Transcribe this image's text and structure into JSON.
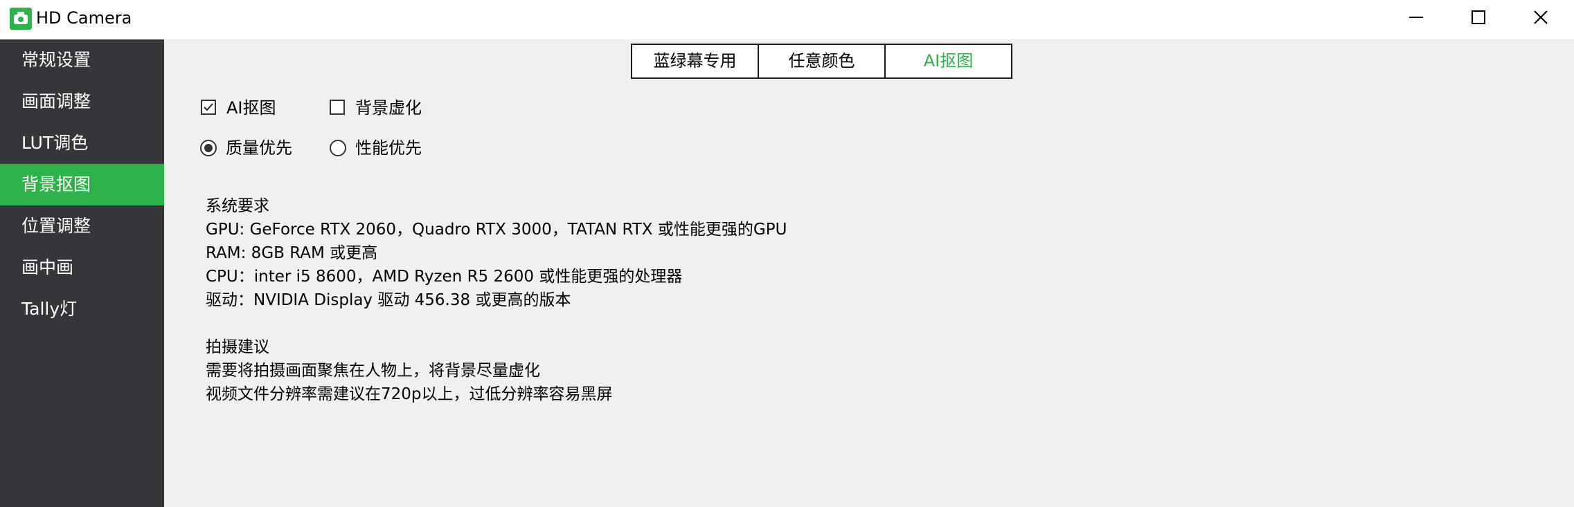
{
  "window": {
    "title": "HD Camera",
    "accent_color": "#2db34a",
    "sidebar_color": "#353639",
    "controls": [
      "minimize-icon",
      "maximize-icon",
      "close-icon"
    ]
  },
  "sidebar": {
    "items": [
      {
        "label": "常规设置",
        "active": false
      },
      {
        "label": "画面调整",
        "active": false
      },
      {
        "label": "LUT调色",
        "active": false
      },
      {
        "label": "背景抠图",
        "active": true
      },
      {
        "label": "位置调整",
        "active": false
      },
      {
        "label": "画中画",
        "active": false
      },
      {
        "label": "Tally灯",
        "active": false
      }
    ]
  },
  "tabs": [
    {
      "label": "蓝绿幕专用",
      "active": false
    },
    {
      "label": "任意颜色",
      "active": false
    },
    {
      "label": "AI抠图",
      "active": true
    }
  ],
  "options": {
    "ai_matting": {
      "label": "AI抠图",
      "checked": true
    },
    "background_blur": {
      "label": "背景虚化",
      "checked": false
    },
    "quality_first": {
      "label": "质量优先",
      "selected": true
    },
    "performance_first": {
      "label": "性能优先",
      "selected": false
    }
  },
  "requirements": {
    "heading": "系统要求",
    "gpu": "GPU: GeForce RTX 2060，Quadro RTX 3000，TATAN RTX 或性能更强的GPU",
    "ram": "RAM: 8GB RAM 或更高",
    "cpu": "CPU：inter i5 8600，AMD Ryzen R5 2600 或性能更强的处理器",
    "driver": "驱动：NVIDIA Display 驱动 456.38 或更高的版本"
  },
  "suggestions": {
    "heading": "拍摄建议",
    "line1": "需要将拍摄画面聚焦在人物上，将背景尽量虚化",
    "line2": "视频文件分辨率需建议在720p以上，过低分辨率容易黑屏"
  }
}
